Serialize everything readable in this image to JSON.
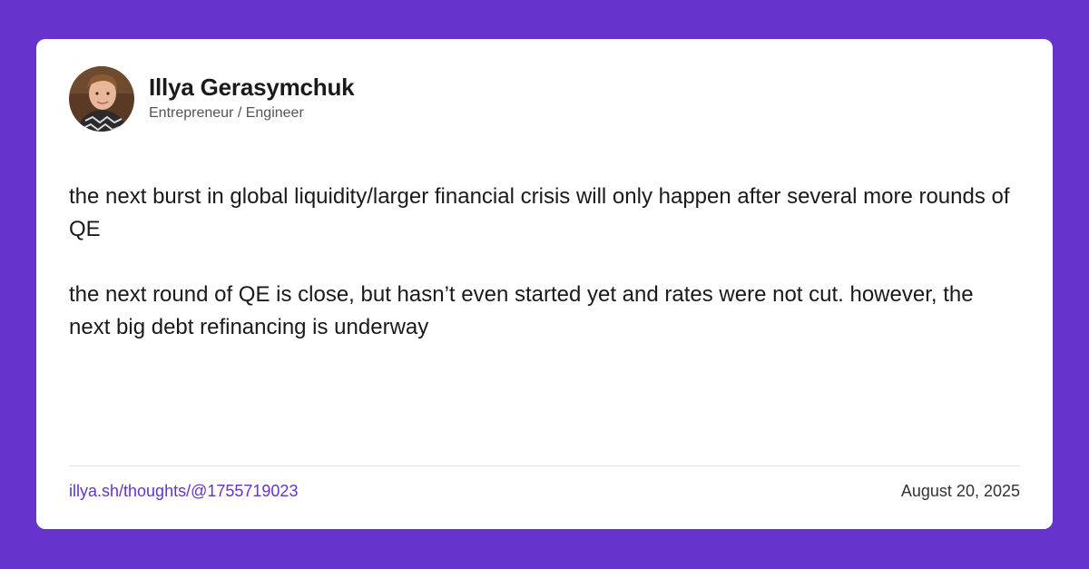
{
  "author": {
    "name": "Illya Gerasymchuk",
    "title": "Entrepreneur / Engineer"
  },
  "post": {
    "paragraphs": [
      "the next burst in global liquidity/larger financial crisis will only happen after several more rounds of QE",
      "the next round of QE is close, but hasn’t even started yet and rates were not cut. however, the next big debt refinancing is underway"
    ]
  },
  "footer": {
    "link": "illya.sh/thoughts/@1755719023",
    "date": "August 20, 2025"
  },
  "colors": {
    "background": "#6633cc",
    "card": "#ffffff",
    "link": "#6633cc"
  }
}
